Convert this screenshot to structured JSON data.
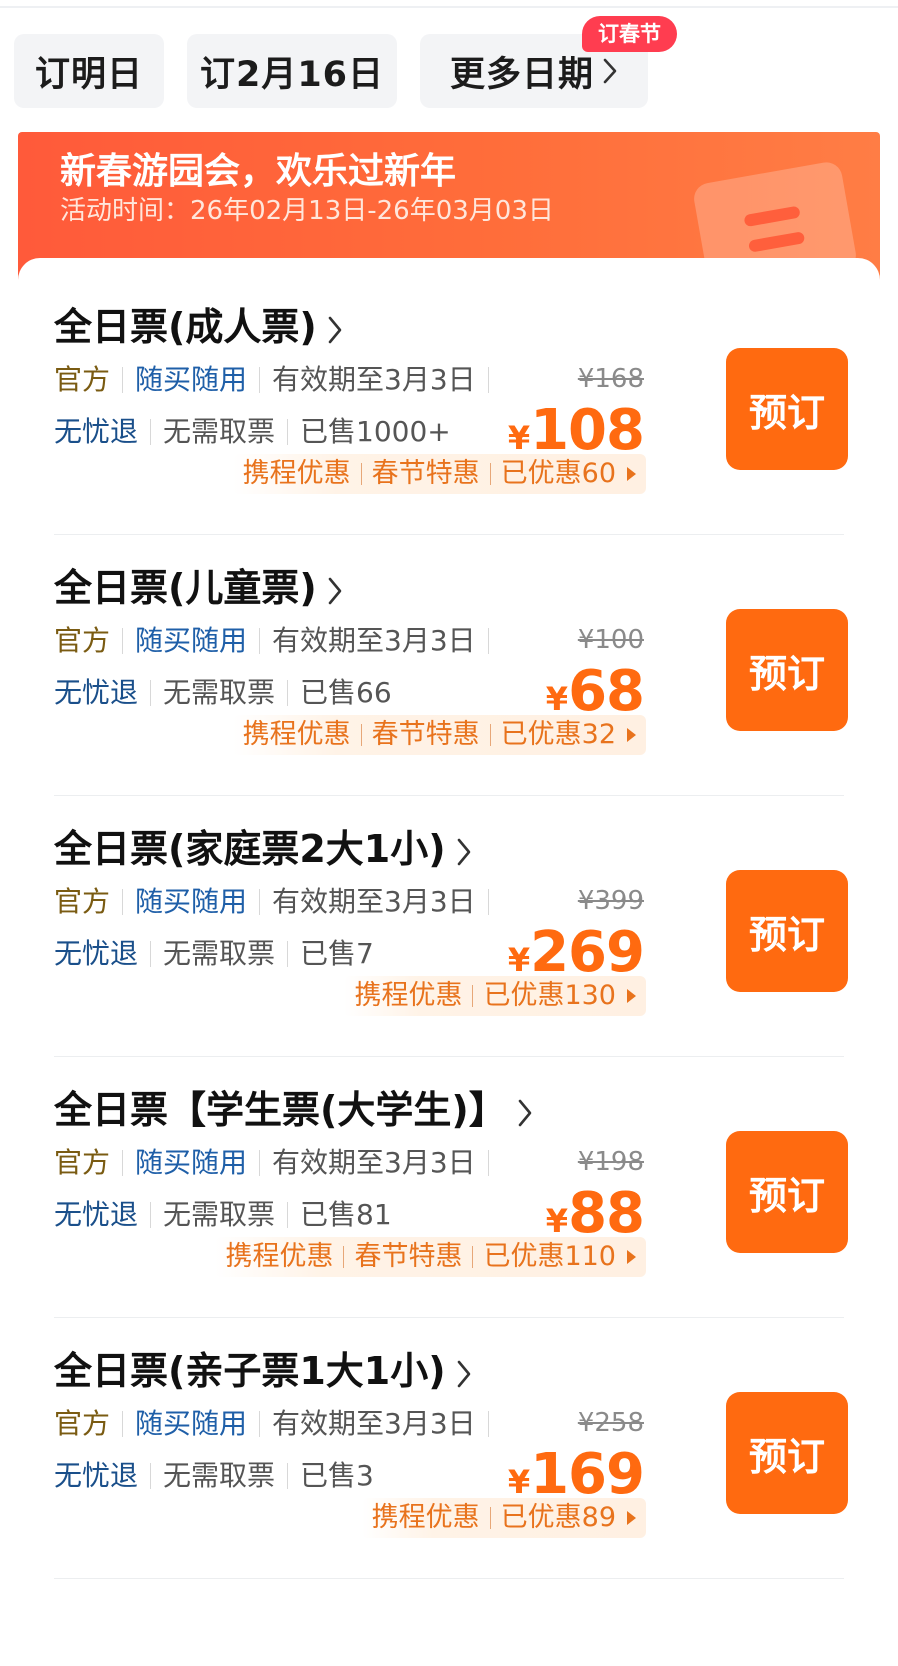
{
  "date_tabs": [
    {
      "label": "订明日"
    },
    {
      "label": "订2月16日"
    },
    {
      "label": "更多日期"
    }
  ],
  "spring_badge": "订春节",
  "banner": {
    "title": "新春游园会，欢乐过新年",
    "time": "活动时间：26年02月13日-26年03月03日"
  },
  "tickets": [
    {
      "name": "全日票(成人票)",
      "tag_official": "官方",
      "tag_anytime": "随买随用",
      "validity": "有效期至3月3日",
      "tag_refund": "无忧退",
      "tag_noticket": "无需取票",
      "sold": "已售1000+",
      "original_price": "¥168",
      "currency": "¥",
      "price": "108",
      "promos": [
        "携程优惠",
        "春节特惠",
        "已优惠60"
      ],
      "book_label": "预订"
    },
    {
      "name": "全日票(儿童票)",
      "tag_official": "官方",
      "tag_anytime": "随买随用",
      "validity": "有效期至3月3日",
      "tag_refund": "无忧退",
      "tag_noticket": "无需取票",
      "sold": "已售66",
      "original_price": "¥100",
      "currency": "¥",
      "price": "68",
      "promos": [
        "携程优惠",
        "春节特惠",
        "已优惠32"
      ],
      "book_label": "预订"
    },
    {
      "name": "全日票(家庭票2大1小)",
      "tag_official": "官方",
      "tag_anytime": "随买随用",
      "validity": "有效期至3月3日",
      "tag_refund": "无忧退",
      "tag_noticket": "无需取票",
      "sold": "已售7",
      "original_price": "¥399",
      "currency": "¥",
      "price": "269",
      "promos": [
        "携程优惠",
        "已优惠130"
      ],
      "book_label": "预订"
    },
    {
      "name": "全日票【学生票(大学生)】",
      "tag_official": "官方",
      "tag_anytime": "随买随用",
      "validity": "有效期至3月3日",
      "tag_refund": "无忧退",
      "tag_noticket": "无需取票",
      "sold": "已售81",
      "original_price": "¥198",
      "currency": "¥",
      "price": "88",
      "promos": [
        "携程优惠",
        "春节特惠",
        "已优惠110"
      ],
      "book_label": "预订"
    },
    {
      "name": "全日票(亲子票1大1小)",
      "tag_official": "官方",
      "tag_anytime": "随买随用",
      "validity": "有效期至3月3日",
      "tag_refund": "无忧退",
      "tag_noticket": "无需取票",
      "sold": "已售3",
      "original_price": "¥258",
      "currency": "¥",
      "price": "169",
      "promos": [
        "携程优惠",
        "已优惠89"
      ],
      "book_label": "预订"
    }
  ],
  "colors": {
    "accent": "#ff6a10",
    "promo_text": "#e8731d",
    "banner": "#ff5a3a",
    "badge": "#ff3d50"
  }
}
